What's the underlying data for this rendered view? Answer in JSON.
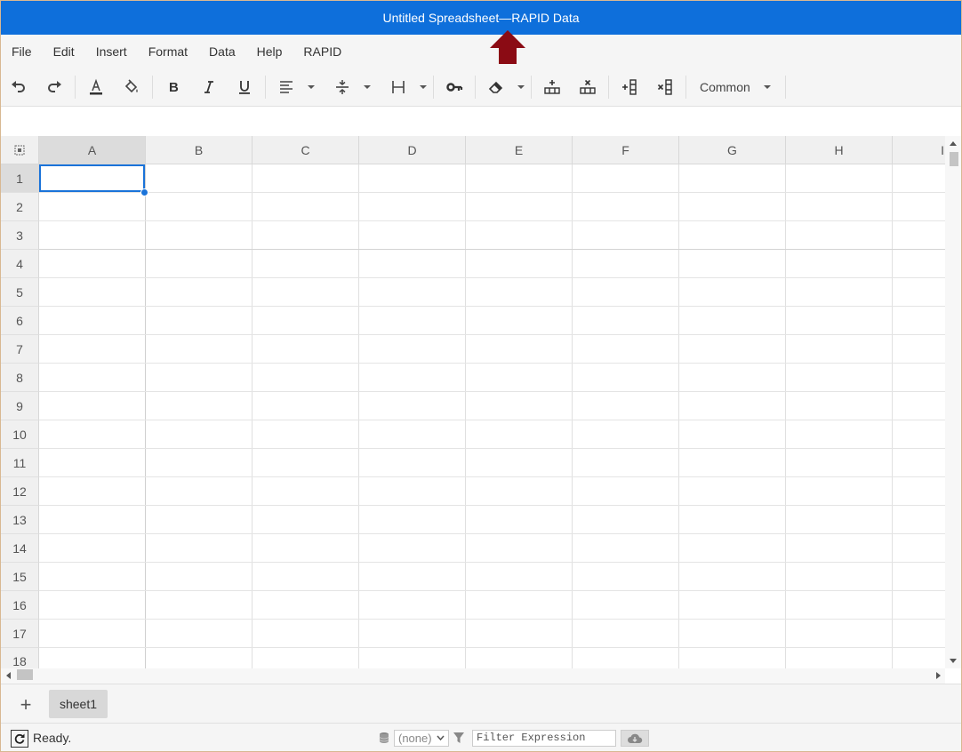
{
  "window": {
    "title": "Untitled Spreadsheet—RAPID Data"
  },
  "menu": [
    "File",
    "Edit",
    "Insert",
    "Format",
    "Data",
    "Help",
    "RAPID"
  ],
  "toolbar": {
    "font_family_label": "Common"
  },
  "grid": {
    "columns": [
      "A",
      "B",
      "C",
      "D",
      "E",
      "F",
      "G",
      "H",
      "I"
    ],
    "rows": [
      "1",
      "2",
      "3",
      "4",
      "5",
      "6",
      "7",
      "8",
      "9",
      "10",
      "11",
      "12",
      "13",
      "14",
      "15",
      "16",
      "17",
      "18"
    ],
    "selected_cell": "A1"
  },
  "sheets": {
    "add_label": "+",
    "tabs": [
      "sheet1"
    ]
  },
  "status": {
    "text": "Ready.",
    "datasource_value": "(none)",
    "filter_placeholder": "Filter Expression"
  },
  "colors": {
    "titlebar": "#0e6fdb",
    "selection": "#1a73d9",
    "arrow": "#8b0b14"
  }
}
